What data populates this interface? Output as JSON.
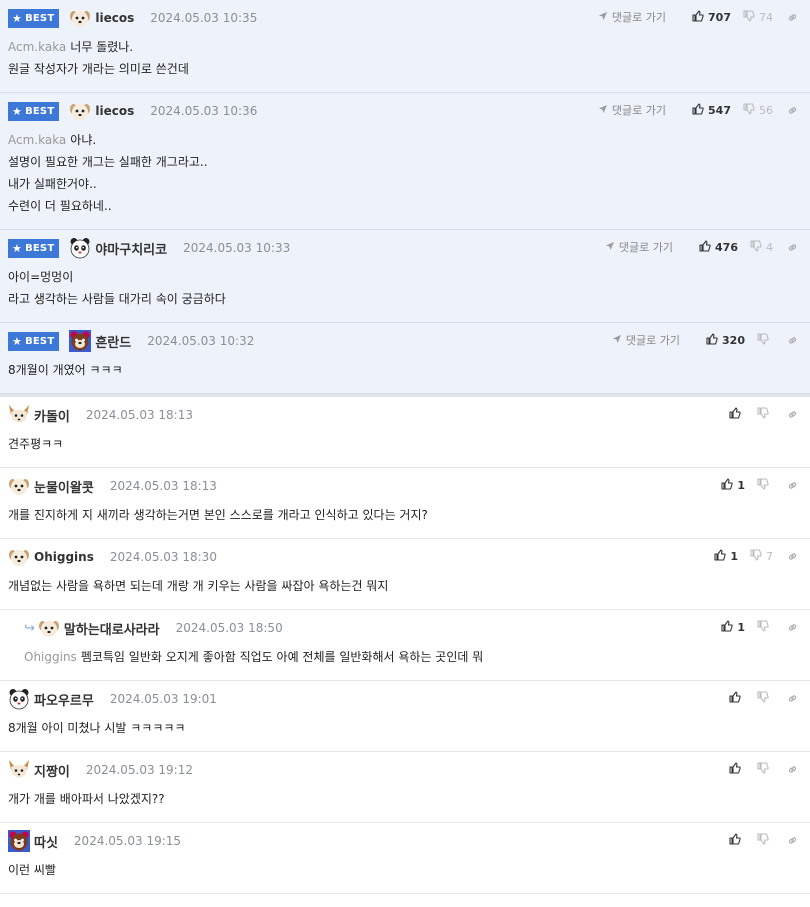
{
  "ui": {
    "best_label": "BEST",
    "goto_label": "댓글로 가기"
  },
  "colors": {
    "best_bg": "#eef2fa",
    "badge": "#3d78d8",
    "date": "#8a8f98"
  },
  "comments": [
    {
      "best": true,
      "avatar": "white-dog",
      "nick": "liecos",
      "date": "2024.05.03 10:35",
      "up": "707",
      "down": "74",
      "mention": "Acm.kaka",
      "lines": [
        "너무 돌렸나.",
        "원글 작성자가 개라는 의미로 쓴건데"
      ]
    },
    {
      "best": true,
      "avatar": "white-dog",
      "nick": "liecos",
      "date": "2024.05.03 10:36",
      "up": "547",
      "down": "56",
      "mention": "Acm.kaka",
      "lines": [
        "아냐.",
        "설명이 필요한 개그는 실패한 개그라고..",
        "내가 실패한거야..",
        "수련이 더 필요하네.."
      ]
    },
    {
      "best": true,
      "avatar": "panda",
      "nick": "야마구치리코",
      "date": "2024.05.03 10:33",
      "up": "476",
      "down": "4",
      "mention": "",
      "lines": [
        "아이=멍멍이",
        "라고 생각하는 사람들 대가리 속이 궁금하다"
      ]
    },
    {
      "best": true,
      "avatar": "bear",
      "nick": "흔란드",
      "date": "2024.05.03 10:32",
      "up": "320",
      "down": "",
      "mention": "",
      "lines": [
        "8개월이 개였어 ㅋㅋㅋ"
      ]
    },
    {
      "best": false,
      "avatar": "fox",
      "nick": "카돌이",
      "date": "2024.05.03 18:13",
      "up": "",
      "down": "",
      "mention": "",
      "lines": [
        "견주평ㅋㅋ"
      ]
    },
    {
      "best": false,
      "avatar": "white-dog",
      "nick": "눈물이왈콧",
      "date": "2024.05.03 18:13",
      "up": "1",
      "down": "",
      "mention": "",
      "lines": [
        "개를 진지하게 지 새끼라 생각하는거면 본인 스스로를 개라고 인식하고 있다는 거지?"
      ]
    },
    {
      "best": false,
      "avatar": "white-dog",
      "nick": "Ohiggins",
      "date": "2024.05.03 18:30",
      "up": "1",
      "down": "7",
      "mention": "",
      "lines": [
        "개념없는 사람을 욕하면 되는데 개랑 개 키우는 사람을 싸잡아 욕하는건 뭐지"
      ]
    },
    {
      "best": false,
      "reply": true,
      "avatar": "white-dog",
      "nick": "말하는대로사라라",
      "date": "2024.05.03 18:50",
      "up": "1",
      "down": "",
      "mention": "Ohiggins",
      "lines": [
        "펨코특임 일반화 오지게 좋아함 직업도 아예 전체를 일반화해서 욕하는 곳인데 뭐"
      ]
    },
    {
      "best": false,
      "avatar": "panda",
      "nick": "파오우르무",
      "date": "2024.05.03 19:01",
      "up": "",
      "down": "",
      "mention": "",
      "lines": [
        "8개월 아이 미쳤나 시발 ㅋㅋㅋㅋㅋ"
      ]
    },
    {
      "best": false,
      "avatar": "fox",
      "nick": "지짱이",
      "date": "2024.05.03 19:12",
      "up": "",
      "down": "",
      "mention": "",
      "lines": [
        "개가 개를 배아파서 나았겠지??"
      ]
    },
    {
      "best": false,
      "avatar": "bear",
      "nick": "따싯",
      "date": "2024.05.03 19:15",
      "up": "",
      "down": "",
      "mention": "",
      "lines": [
        "이런 씨빨"
      ]
    }
  ]
}
